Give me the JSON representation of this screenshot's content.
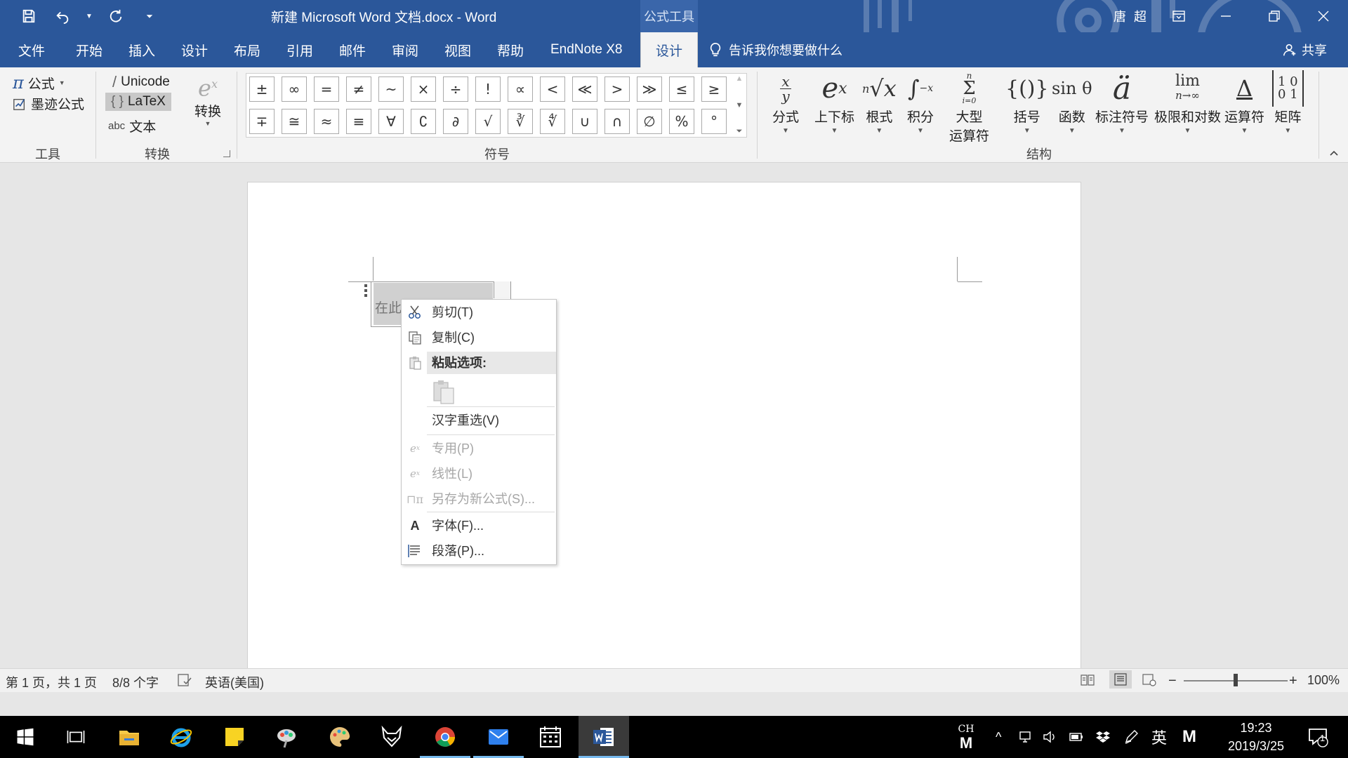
{
  "app": {
    "title": "新建 Microsoft Word 文档.docx  -  Word",
    "context_tab_title": "公式工具",
    "user": "唐 超"
  },
  "tabs": [
    {
      "label": "文件"
    },
    {
      "label": "开始"
    },
    {
      "label": "插入"
    },
    {
      "label": "设计"
    },
    {
      "label": "布局"
    },
    {
      "label": "引用"
    },
    {
      "label": "邮件"
    },
    {
      "label": "审阅"
    },
    {
      "label": "视图"
    },
    {
      "label": "帮助"
    },
    {
      "label": "EndNote X8"
    },
    {
      "label": "设计"
    }
  ],
  "tell_me": "告诉我你想要做什么",
  "share": "共享",
  "ribbon": {
    "tools": {
      "label": "工具",
      "equation": "公式",
      "ink_equation": "墨迹公式"
    },
    "convert": {
      "label": "转换",
      "unicode": "Unicode",
      "latex": "LaTeX",
      "text": "文本",
      "abc": "abc",
      "convert_button": "转换"
    },
    "symbols": {
      "label": "符号",
      "row1": [
        "±",
        "∞",
        "=",
        "≠",
        "~",
        "×",
        "÷",
        "!",
        "∝",
        "<",
        "≪",
        ">",
        "≫",
        "≤",
        "≥"
      ],
      "row2": [
        "∓",
        "≅",
        "≈",
        "≡",
        "∀",
        "∁",
        "∂",
        "√",
        "∛",
        "∜",
        "∪",
        "∩",
        "∅",
        "%",
        "°"
      ]
    },
    "structures": {
      "label": "结构",
      "items": [
        {
          "label": "分式"
        },
        {
          "label": "上下标"
        },
        {
          "label": "根式"
        },
        {
          "label": "积分"
        },
        {
          "label": "大型",
          "label2": "运算符"
        },
        {
          "label": "括号"
        },
        {
          "label": "函数"
        },
        {
          "label": "标注符号"
        },
        {
          "label": "极限和对数"
        },
        {
          "label": "运算符"
        },
        {
          "label": "矩阵"
        }
      ]
    }
  },
  "document": {
    "equation_placeholder": "在此"
  },
  "context_menu": {
    "items": [
      {
        "label": "剪切(T)",
        "icon": "scissors-icon",
        "enabled": true
      },
      {
        "label": "复制(C)",
        "icon": "copy-icon",
        "enabled": true
      },
      {
        "label": "粘贴选项:",
        "icon": "paste-icon",
        "enabled": true
      },
      {
        "label": "汉字重选(V)",
        "enabled": true
      },
      {
        "label": "专用(P)",
        "icon": "professional-icon",
        "enabled": false
      },
      {
        "label": "线性(L)",
        "icon": "linear-icon",
        "enabled": false
      },
      {
        "label": "另存为新公式(S)...",
        "icon": "save-equation-icon",
        "enabled": false
      },
      {
        "label": "字体(F)...",
        "icon": "font-icon",
        "enabled": true
      },
      {
        "label": "段落(P)...",
        "icon": "paragraph-icon",
        "enabled": true
      }
    ]
  },
  "status": {
    "page": "第 1 页，共 1 页",
    "words": "8/8 个字",
    "language": "英语(美国)",
    "zoom": "100%",
    "zoom_minus": "−",
    "zoom_plus": "+",
    "zoom_fraction": 0.5
  },
  "taskbar": {
    "ime_top": "CH",
    "ime_lang": "英",
    "time": "19:23",
    "date": "2019/3/25",
    "notifications": "1"
  },
  "colors": {
    "word_blue": "#2b579a",
    "ribbon_bg": "#f3f3f3",
    "taskbar_bg": "#000000"
  }
}
